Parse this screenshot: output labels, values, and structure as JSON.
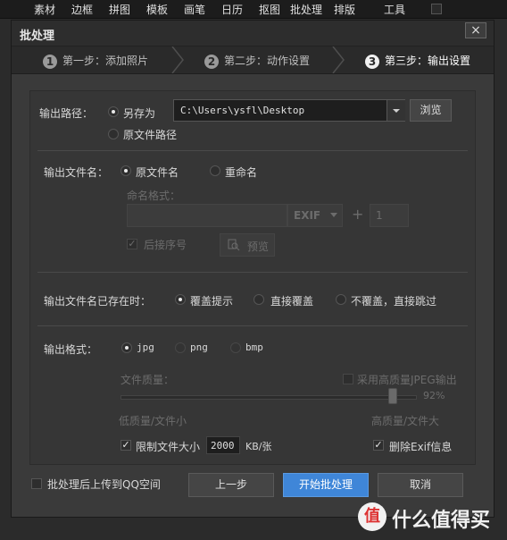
{
  "menubar": {
    "items": [
      "素材",
      "边框",
      "拼图",
      "模板",
      "画笔",
      "日历",
      "抠图",
      "批处理",
      "排版",
      "工具"
    ]
  },
  "window": {
    "title": "批处理",
    "close_label": "×",
    "steps": [
      {
        "num": "1",
        "label": "第一步：添加照片"
      },
      {
        "num": "2",
        "label": "第二步：动作设置"
      },
      {
        "num": "3",
        "label": "第三步：输出设置"
      }
    ]
  },
  "output_path": {
    "label": "输出路径：",
    "save_as_label": "另存为",
    "path_value": "C:\\Users\\ysfl\\Desktop",
    "browse_label": "浏览",
    "original_path_label": "原文件路径",
    "selected": "save_as"
  },
  "output_name": {
    "label": "输出文件名：",
    "original_label": "原文件名",
    "rename_label": "重命名",
    "selected": "original",
    "format_label": "命名格式：",
    "exif_label": "EXIF",
    "plus_label": "+",
    "start_number": "1",
    "append_seq_label": "后接序号",
    "preview_label": "预览"
  },
  "exists": {
    "label": "输出文件名已存在时：",
    "opt_prompt": "覆盖提示",
    "opt_overwrite": "直接覆盖",
    "opt_skip": "不覆盖，直接跳过",
    "selected": "prompt"
  },
  "format": {
    "label": "输出格式：",
    "opt_jpg": "jpg",
    "opt_png": "png",
    "opt_bmp": "bmp",
    "selected": "jpg",
    "quality_label": "文件质量：",
    "hq_jpeg_label": "采用高质量JPEG输出",
    "quality_value": 92,
    "quality_text": "92%",
    "low_label": "低质量/文件小",
    "high_label": "高质量/文件大",
    "limit_size_label": "限制文件大小",
    "limit_size_value": "2000",
    "limit_size_unit": "KB/张",
    "limit_size_checked": true,
    "remove_exif_label": "删除Exif信息",
    "remove_exif_checked": true
  },
  "footer": {
    "upload_qq_label": "批处理后上传到QQ空间",
    "prev_label": "上一步",
    "start_label": "开始批处理",
    "cancel_label": "取消"
  },
  "watermark": {
    "text": "什么值得买",
    "logo_char": "值"
  },
  "colors": {
    "accent": "#3f86d8",
    "window_bg": "#3a3a3a"
  }
}
